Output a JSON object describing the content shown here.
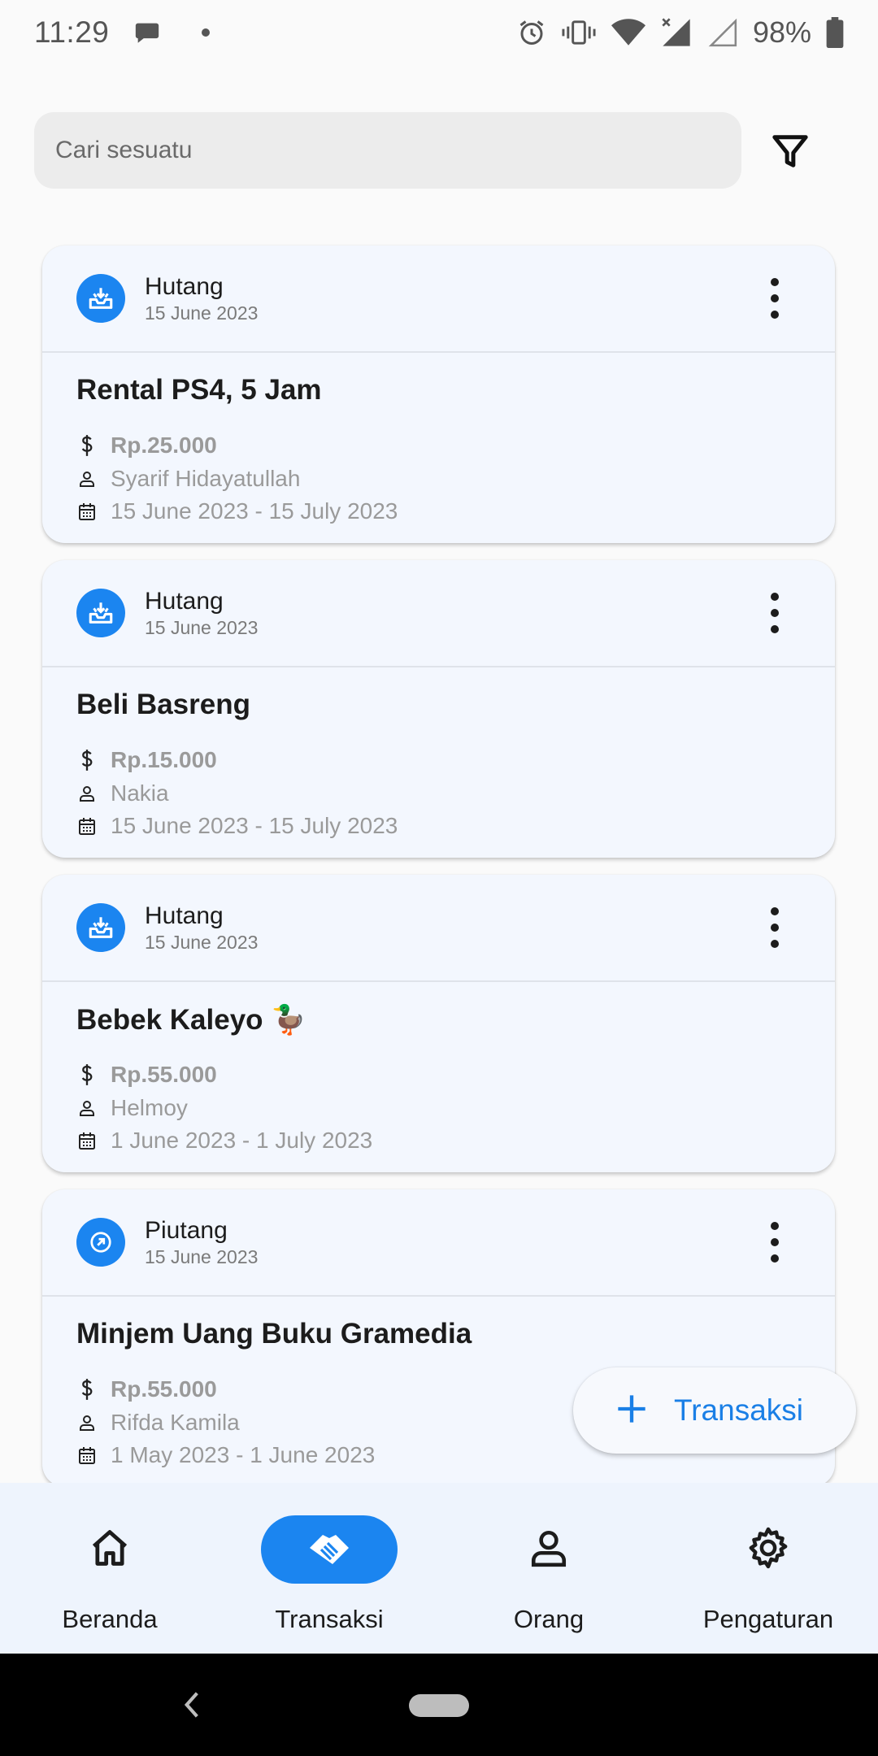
{
  "status_bar": {
    "time": "11:29",
    "battery": "98%",
    "icons": [
      "chat-bubble-icon",
      "alarm-icon",
      "vibrate-icon",
      "wifi-icon",
      "signal-icon",
      "signal-empty-icon",
      "battery-icon"
    ]
  },
  "search": {
    "placeholder": "Cari sesuatu"
  },
  "transactions": [
    {
      "type": "Hutang",
      "date": "15 June 2023",
      "title": "Rental PS4, 5 Jam",
      "amount": "Rp.25.000",
      "person": "Syarif Hidayatullah",
      "period": "15 June 2023  - 15 July 2023",
      "icon": "inbox-receive-icon"
    },
    {
      "type": "Hutang",
      "date": "15 June 2023",
      "title": "Beli Basreng",
      "amount": "Rp.15.000",
      "person": "Nakia",
      "period": "15 June 2023  - 15 July 2023",
      "icon": "inbox-receive-icon"
    },
    {
      "type": "Hutang",
      "date": "15 June 2023",
      "title": "Bebek Kaleyo 🦆",
      "amount": "Rp.55.000",
      "person": "Helmoy",
      "period": "1 June 2023  - 1 July 2023",
      "icon": "inbox-receive-icon"
    },
    {
      "type": "Piutang",
      "date": "15 June 2023",
      "title": "Minjem Uang Buku Gramedia",
      "amount": "Rp.55.000",
      "person": "Rifda Kamila",
      "period": "1 May 2023  - 1 June 2023",
      "icon": "arrow-up-right-circle-icon"
    }
  ],
  "fab": {
    "label": "Transaksi"
  },
  "bottom_nav": {
    "items": [
      {
        "label": "Beranda",
        "icon": "home-icon"
      },
      {
        "label": "Transaksi",
        "icon": "handshake-icon",
        "active": true
      },
      {
        "label": "Orang",
        "icon": "person-icon"
      },
      {
        "label": "Pengaturan",
        "icon": "settings-gear-icon"
      }
    ]
  },
  "colors": {
    "accent": "#1b85f0",
    "card_bg": "#f3f7fe",
    "nav_bg": "#eef4fd",
    "muted_text": "#9a9a9a"
  }
}
